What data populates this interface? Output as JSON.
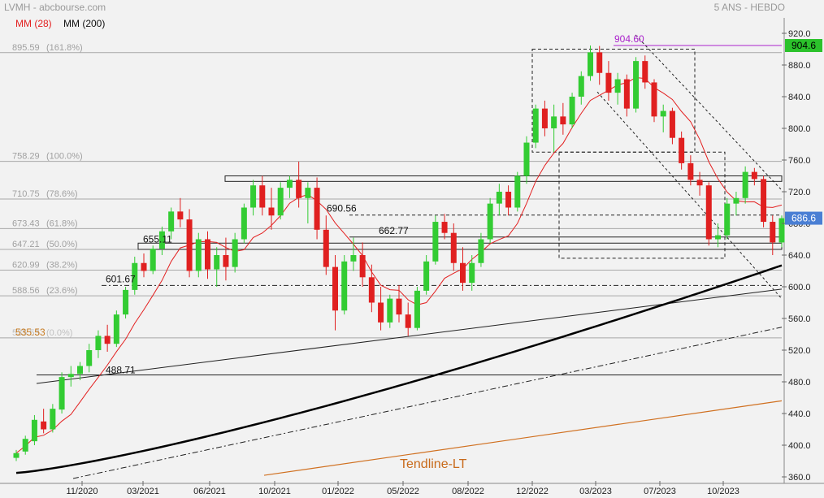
{
  "header": {
    "symbol_source": "LVMH - abcbourse.com",
    "period": "5 ANS - HEBDO",
    "legend": [
      {
        "label": "MM (28)",
        "color": "#e32020"
      },
      {
        "label": "MM (200)",
        "color": "#111111"
      }
    ]
  },
  "colors": {
    "up": "#33cc33",
    "down": "#e02020",
    "ma28": "#e32020",
    "ma200": "#000000",
    "fib": "#999999",
    "tendline_lt": "#d07020",
    "high_marker": "#aa22cc"
  },
  "chart_data": {
    "type": "candlestick",
    "title": "LVMH",
    "ylim": [
      360,
      920
    ],
    "y_ticks": [
      360,
      400,
      440,
      480,
      520,
      560,
      600,
      640,
      680,
      720,
      760,
      800,
      840,
      880,
      920
    ],
    "x_ticks": [
      "11/2020",
      "03/2021",
      "06/2021",
      "10/2021",
      "01/2022",
      "05/2022",
      "08/2022",
      "12/2022",
      "03/2023",
      "07/2023",
      "10/2023"
    ],
    "last_price": "686.6",
    "high_price": "904.6",
    "fibonacci": [
      {
        "label": "895.59",
        "pct": "(161.8%)",
        "value": 895.59
      },
      {
        "label": "758.29",
        "pct": "(100.0%)",
        "value": 758.29
      },
      {
        "label": "710.75",
        "pct": "(78.6%)",
        "value": 710.75
      },
      {
        "label": "673.43",
        "pct": "(61.8%)",
        "value": 673.43
      },
      {
        "label": "647.21",
        "pct": "(50.0%)",
        "value": 647.21
      },
      {
        "label": "620.99",
        "pct": "(38.2%)",
        "value": 620.99
      },
      {
        "label": "588.56",
        "pct": "(23.6%)",
        "value": 588.56
      },
      {
        "label": "535.53",
        "pct": "(0.0%)",
        "value": 535.53
      }
    ],
    "annotations": [
      {
        "text": "904.60",
        "value": 904.6
      },
      {
        "text": "690.56",
        "value": 690.56
      },
      {
        "text": "662.77",
        "value": 662.77
      },
      {
        "text": "655.11",
        "value": 655.11
      },
      {
        "text": "601.67",
        "value": 601.67
      },
      {
        "text": "488.71",
        "value": 488.71
      },
      {
        "text": "535.53",
        "value": 535.53
      }
    ],
    "tendline_label": "Tendline-LT",
    "candles": [
      {
        "date": "2020-10-26",
        "o": 384,
        "h": 394,
        "l": 380,
        "c": 390
      },
      {
        "date": "2020-11-09",
        "o": 392,
        "h": 412,
        "l": 388,
        "c": 408
      },
      {
        "date": "2020-11-23",
        "o": 405,
        "h": 438,
        "l": 400,
        "c": 432
      },
      {
        "date": "2020-12-07",
        "o": 430,
        "h": 446,
        "l": 415,
        "c": 420
      },
      {
        "date": "2020-12-21",
        "o": 420,
        "h": 452,
        "l": 416,
        "c": 446
      },
      {
        "date": "2021-01-04",
        "o": 445,
        "h": 492,
        "l": 440,
        "c": 486
      },
      {
        "date": "2021-01-18",
        "o": 486,
        "h": 500,
        "l": 474,
        "c": 490
      },
      {
        "date": "2021-02-01",
        "o": 490,
        "h": 505,
        "l": 482,
        "c": 500
      },
      {
        "date": "2021-02-15",
        "o": 500,
        "h": 528,
        "l": 492,
        "c": 520
      },
      {
        "date": "2021-03-01",
        "o": 520,
        "h": 545,
        "l": 510,
        "c": 538
      },
      {
        "date": "2021-03-15",
        "o": 538,
        "h": 552,
        "l": 518,
        "c": 528
      },
      {
        "date": "2021-03-29",
        "o": 528,
        "h": 570,
        "l": 524,
        "c": 565
      },
      {
        "date": "2021-04-12",
        "o": 565,
        "h": 600,
        "l": 560,
        "c": 596
      },
      {
        "date": "2021-04-26",
        "o": 596,
        "h": 638,
        "l": 590,
        "c": 630
      },
      {
        "date": "2021-05-10",
        "o": 630,
        "h": 642,
        "l": 612,
        "c": 620
      },
      {
        "date": "2021-05-24",
        "o": 620,
        "h": 652,
        "l": 616,
        "c": 648
      },
      {
        "date": "2021-06-07",
        "o": 648,
        "h": 676,
        "l": 640,
        "c": 670
      },
      {
        "date": "2021-06-21",
        "o": 670,
        "h": 700,
        "l": 660,
        "c": 695
      },
      {
        "date": "2021-07-05",
        "o": 695,
        "h": 712,
        "l": 675,
        "c": 685
      },
      {
        "date": "2021-07-19",
        "o": 685,
        "h": 698,
        "l": 612,
        "c": 620
      },
      {
        "date": "2021-08-02",
        "o": 620,
        "h": 668,
        "l": 612,
        "c": 660
      },
      {
        "date": "2021-08-16",
        "o": 660,
        "h": 670,
        "l": 610,
        "c": 622
      },
      {
        "date": "2021-08-30",
        "o": 622,
        "h": 650,
        "l": 600,
        "c": 640
      },
      {
        "date": "2021-09-13",
        "o": 640,
        "h": 662,
        "l": 608,
        "c": 625
      },
      {
        "date": "2021-09-27",
        "o": 625,
        "h": 668,
        "l": 618,
        "c": 660
      },
      {
        "date": "2021-10-11",
        "o": 660,
        "h": 705,
        "l": 655,
        "c": 700
      },
      {
        "date": "2021-10-25",
        "o": 700,
        "h": 735,
        "l": 690,
        "c": 728
      },
      {
        "date": "2021-11-08",
        "o": 728,
        "h": 740,
        "l": 690,
        "c": 700
      },
      {
        "date": "2021-11-22",
        "o": 700,
        "h": 725,
        "l": 672,
        "c": 690
      },
      {
        "date": "2021-12-06",
        "o": 690,
        "h": 732,
        "l": 685,
        "c": 725
      },
      {
        "date": "2021-12-20",
        "o": 725,
        "h": 740,
        "l": 712,
        "c": 735
      },
      {
        "date": "2022-01-03",
        "o": 735,
        "h": 758,
        "l": 700,
        "c": 712
      },
      {
        "date": "2022-01-17",
        "o": 712,
        "h": 732,
        "l": 680,
        "c": 725
      },
      {
        "date": "2022-01-31",
        "o": 725,
        "h": 738,
        "l": 660,
        "c": 672
      },
      {
        "date": "2022-02-14",
        "o": 672,
        "h": 690,
        "l": 615,
        "c": 625
      },
      {
        "date": "2022-02-28",
        "o": 625,
        "h": 640,
        "l": 545,
        "c": 570
      },
      {
        "date": "2022-03-14",
        "o": 570,
        "h": 640,
        "l": 565,
        "c": 632
      },
      {
        "date": "2022-03-28",
        "o": 632,
        "h": 662,
        "l": 620,
        "c": 640
      },
      {
        "date": "2022-04-11",
        "o": 640,
        "h": 656,
        "l": 600,
        "c": 612
      },
      {
        "date": "2022-04-25",
        "o": 612,
        "h": 628,
        "l": 568,
        "c": 580
      },
      {
        "date": "2022-05-09",
        "o": 580,
        "h": 600,
        "l": 545,
        "c": 555
      },
      {
        "date": "2022-05-23",
        "o": 555,
        "h": 590,
        "l": 548,
        "c": 585
      },
      {
        "date": "2022-06-06",
        "o": 585,
        "h": 602,
        "l": 555,
        "c": 565
      },
      {
        "date": "2022-06-20",
        "o": 565,
        "h": 580,
        "l": 538,
        "c": 548
      },
      {
        "date": "2022-07-04",
        "o": 548,
        "h": 600,
        "l": 545,
        "c": 595
      },
      {
        "date": "2022-07-18",
        "o": 595,
        "h": 640,
        "l": 590,
        "c": 632
      },
      {
        "date": "2022-08-01",
        "o": 632,
        "h": 690,
        "l": 628,
        "c": 682
      },
      {
        "date": "2022-08-15",
        "o": 682,
        "h": 692,
        "l": 660,
        "c": 668
      },
      {
        "date": "2022-08-29",
        "o": 668,
        "h": 680,
        "l": 620,
        "c": 630
      },
      {
        "date": "2022-09-12",
        "o": 630,
        "h": 650,
        "l": 595,
        "c": 605
      },
      {
        "date": "2022-09-26",
        "o": 605,
        "h": 640,
        "l": 595,
        "c": 630
      },
      {
        "date": "2022-10-10",
        "o": 630,
        "h": 668,
        "l": 625,
        "c": 660
      },
      {
        "date": "2022-10-24",
        "o": 660,
        "h": 712,
        "l": 655,
        "c": 705
      },
      {
        "date": "2022-11-07",
        "o": 705,
        "h": 730,
        "l": 690,
        "c": 720
      },
      {
        "date": "2022-11-21",
        "o": 720,
        "h": 728,
        "l": 690,
        "c": 700
      },
      {
        "date": "2022-12-05",
        "o": 700,
        "h": 745,
        "l": 695,
        "c": 740
      },
      {
        "date": "2022-12-19",
        "o": 740,
        "h": 790,
        "l": 730,
        "c": 782
      },
      {
        "date": "2023-01-02",
        "o": 782,
        "h": 830,
        "l": 775,
        "c": 825
      },
      {
        "date": "2023-01-16",
        "o": 825,
        "h": 835,
        "l": 790,
        "c": 800
      },
      {
        "date": "2023-01-30",
        "o": 800,
        "h": 830,
        "l": 770,
        "c": 815
      },
      {
        "date": "2023-02-13",
        "o": 815,
        "h": 832,
        "l": 792,
        "c": 805
      },
      {
        "date": "2023-02-27",
        "o": 805,
        "h": 845,
        "l": 800,
        "c": 840
      },
      {
        "date": "2023-03-13",
        "o": 840,
        "h": 872,
        "l": 830,
        "c": 866
      },
      {
        "date": "2023-03-27",
        "o": 866,
        "h": 904.6,
        "l": 860,
        "c": 896
      },
      {
        "date": "2023-04-10",
        "o": 896,
        "h": 904,
        "l": 855,
        "c": 870
      },
      {
        "date": "2023-04-24",
        "o": 870,
        "h": 885,
        "l": 835,
        "c": 845
      },
      {
        "date": "2023-05-08",
        "o": 845,
        "h": 870,
        "l": 830,
        "c": 862
      },
      {
        "date": "2023-05-22",
        "o": 862,
        "h": 868,
        "l": 815,
        "c": 825
      },
      {
        "date": "2023-06-05",
        "o": 825,
        "h": 890,
        "l": 820,
        "c": 885
      },
      {
        "date": "2023-06-19",
        "o": 885,
        "h": 892,
        "l": 850,
        "c": 858
      },
      {
        "date": "2023-07-03",
        "o": 858,
        "h": 862,
        "l": 808,
        "c": 815
      },
      {
        "date": "2023-07-17",
        "o": 815,
        "h": 830,
        "l": 795,
        "c": 822
      },
      {
        "date": "2023-07-31",
        "o": 822,
        "h": 826,
        "l": 780,
        "c": 788
      },
      {
        "date": "2023-08-14",
        "o": 788,
        "h": 796,
        "l": 748,
        "c": 756
      },
      {
        "date": "2023-08-28",
        "o": 756,
        "h": 766,
        "l": 728,
        "c": 735
      },
      {
        "date": "2023-09-11",
        "o": 735,
        "h": 745,
        "l": 715,
        "c": 728
      },
      {
        "date": "2023-09-25",
        "o": 728,
        "h": 732,
        "l": 652,
        "c": 660
      },
      {
        "date": "2023-10-09",
        "o": 660,
        "h": 680,
        "l": 650,
        "c": 665
      },
      {
        "date": "2023-10-23",
        "o": 665,
        "h": 712,
        "l": 660,
        "c": 705
      },
      {
        "date": "2023-11-06",
        "o": 705,
        "h": 720,
        "l": 690,
        "c": 712
      },
      {
        "date": "2023-11-20",
        "o": 712,
        "h": 752,
        "l": 705,
        "c": 745
      },
      {
        "date": "2023-12-04",
        "o": 745,
        "h": 750,
        "l": 728,
        "c": 736
      },
      {
        "date": "2023-12-18",
        "o": 736,
        "h": 740,
        "l": 675,
        "c": 682
      },
      {
        "date": "2024-01-01",
        "o": 682,
        "h": 690,
        "l": 640,
        "c": 656
      },
      {
        "date": "2024-01-15",
        "o": 656,
        "h": 690,
        "l": 650,
        "c": 686.6
      }
    ]
  }
}
